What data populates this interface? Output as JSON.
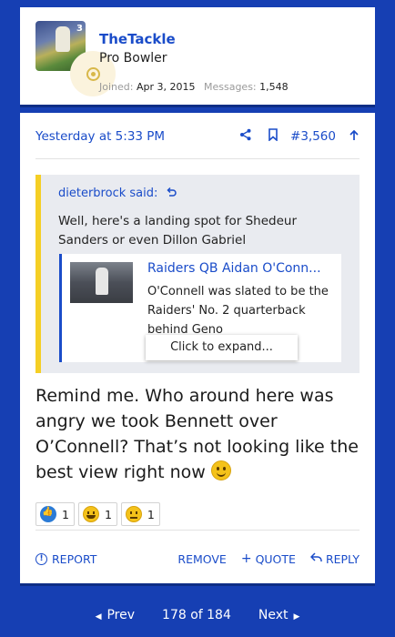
{
  "user": {
    "name": "TheTackle",
    "title": "Pro Bowler",
    "joined_label": "Joined:",
    "joined_value": "Apr 3, 2015",
    "messages_label": "Messages:",
    "messages_value": "1,548",
    "avatar_number": "3"
  },
  "post": {
    "date": "Yesterday at 5:33 PM",
    "number": "#3,560",
    "quote": {
      "author": "dieterbrock said:",
      "text": "Well, here's a landing spot for Shedeur Sanders or even Dillon Gabriel",
      "embed_title": "Raiders QB Aidan O'Conn...",
      "embed_desc": "O'Connell was slated to be the Raiders' No. 2 quarterback behind Geno",
      "expand_label": "Click to expand..."
    },
    "body": "Remind me. Who around here was angry we took Bennett over O’Connell? That’s not looking like the best view right now",
    "reactions": [
      {
        "icon": "like-icon",
        "count": "1"
      },
      {
        "icon": "grin-icon",
        "count": "1"
      },
      {
        "icon": "thinking-icon",
        "count": "1"
      }
    ],
    "actions": {
      "report": "REPORT",
      "remove": "REMOVE",
      "quote": "QUOTE",
      "reply": "REPLY"
    }
  },
  "pager": {
    "prev": "Prev",
    "position": "178 of 184",
    "next": "Next"
  },
  "colors": {
    "background": "#163fb3",
    "link": "#1a4cc9",
    "quote_bar": "#f5cf25",
    "quote_bg": "#e9ebf0"
  }
}
